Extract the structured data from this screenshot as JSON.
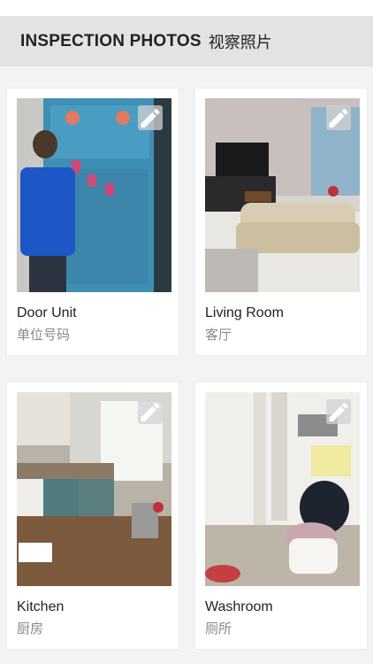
{
  "header": {
    "title": "INSPECTION PHOTOS",
    "subtitle": "视察照片"
  },
  "photos": [
    {
      "label": "Door Unit",
      "sublabel": "单位号码",
      "edit_icon": "pencil-icon"
    },
    {
      "label": "Living Room",
      "sublabel": "客厅",
      "edit_icon": "pencil-icon"
    },
    {
      "label": "Kitchen",
      "sublabel": "厨房",
      "edit_icon": "pencil-icon"
    },
    {
      "label": "Washroom",
      "sublabel": "厕所",
      "edit_icon": "pencil-icon"
    }
  ],
  "colors": {
    "header_bg": "#e3e3e3",
    "page_bg": "#f3f3f3",
    "card_bg": "#ffffff",
    "label_text": "#222222",
    "sublabel_text": "#888888"
  }
}
